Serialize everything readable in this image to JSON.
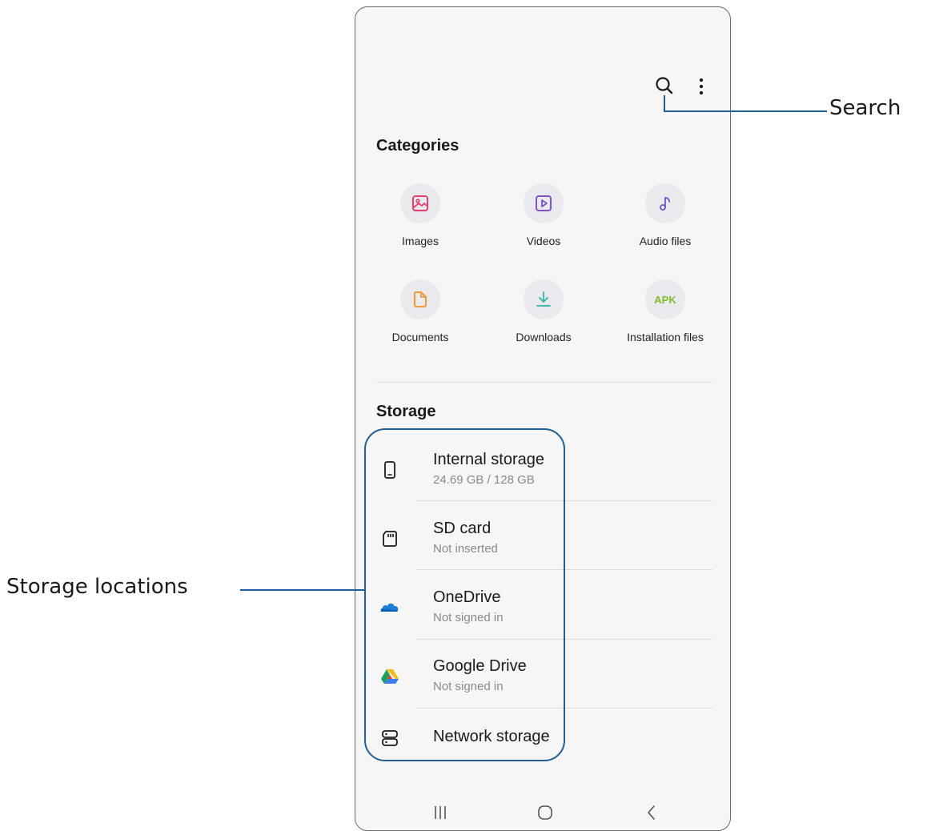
{
  "categories": {
    "title": "Categories",
    "items": [
      {
        "label": "Images",
        "icon": "image-icon",
        "color": "#e0426c"
      },
      {
        "label": "Videos",
        "icon": "video-icon",
        "color": "#8054c4"
      },
      {
        "label": "Audio files",
        "icon": "music-note-icon",
        "color": "#6f55c8"
      },
      {
        "label": "Documents",
        "icon": "document-icon",
        "color": "#f09a37"
      },
      {
        "label": "Downloads",
        "icon": "download-icon",
        "color": "#2fb3a4"
      },
      {
        "label": "Installation files",
        "icon": "apk-icon",
        "color": "#7fbe2e",
        "icon_text": "APK"
      }
    ]
  },
  "storage": {
    "title": "Storage",
    "items": [
      {
        "title": "Internal storage",
        "subtitle": "24.69 GB / 128 GB",
        "icon": "phone-icon"
      },
      {
        "title": "SD card",
        "subtitle": "Not inserted",
        "icon": "sd-card-icon"
      },
      {
        "title": "OneDrive",
        "subtitle": "Not signed in",
        "icon": "onedrive-icon"
      },
      {
        "title": "Google Drive",
        "subtitle": "Not signed in",
        "icon": "google-drive-icon"
      },
      {
        "title": "Network storage",
        "subtitle": "",
        "icon": "network-storage-icon"
      }
    ]
  },
  "callouts": {
    "search": "Search",
    "storage_locations": "Storage locations"
  },
  "accent_color": "#1f5f98"
}
